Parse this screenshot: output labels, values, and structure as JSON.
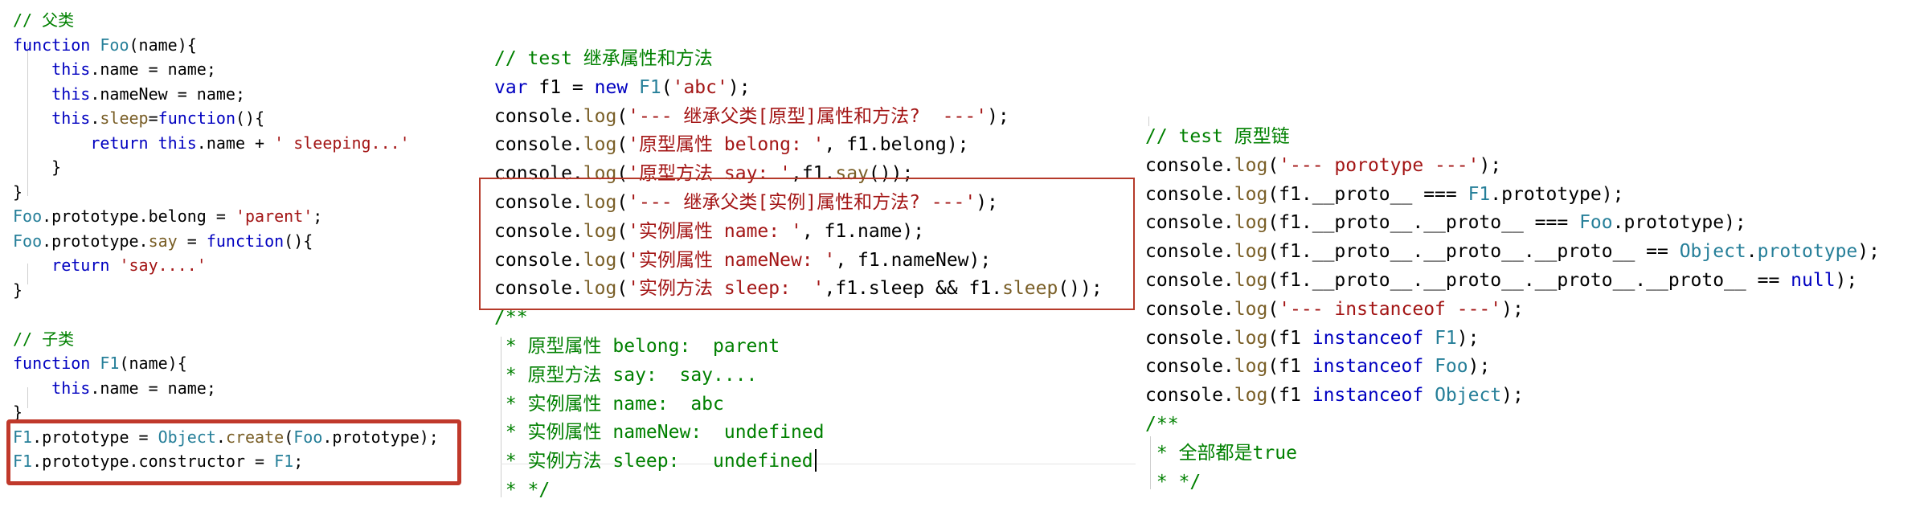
{
  "colors": {
    "keyword": "#0000c0",
    "class": "#267f99",
    "string": "#a31515",
    "comment": "#008000",
    "method": "#795e26",
    "text": "#000000",
    "highlight_box": "#c0392b"
  },
  "left_panel": {
    "lines": [
      [
        {
          "t": "// 父类",
          "c": "comment"
        }
      ],
      [
        {
          "t": "function",
          "c": "keyword"
        },
        {
          "t": " "
        },
        {
          "t": "Foo",
          "c": "class"
        },
        {
          "t": "(name){"
        }
      ],
      [
        {
          "t": "    "
        },
        {
          "t": "this",
          "c": "keyword"
        },
        {
          "t": ".name = name;"
        }
      ],
      [
        {
          "t": "    "
        },
        {
          "t": "this",
          "c": "keyword"
        },
        {
          "t": ".nameNew = name;"
        }
      ],
      [
        {
          "t": "    "
        },
        {
          "t": "this",
          "c": "keyword"
        },
        {
          "t": "."
        },
        {
          "t": "sleep",
          "c": "method"
        },
        {
          "t": "="
        },
        {
          "t": "function",
          "c": "keyword"
        },
        {
          "t": "(){"
        }
      ],
      [
        {
          "t": "        "
        },
        {
          "t": "return",
          "c": "keyword"
        },
        {
          "t": " "
        },
        {
          "t": "this",
          "c": "keyword"
        },
        {
          "t": ".name + "
        },
        {
          "t": "' sleeping...'",
          "c": "string"
        }
      ],
      [
        {
          "t": "    }"
        }
      ],
      [
        {
          "t": "}"
        }
      ],
      [
        {
          "t": "Foo",
          "c": "class"
        },
        {
          "t": ".prototype.belong = "
        },
        {
          "t": "'parent'",
          "c": "string"
        },
        {
          "t": ";"
        }
      ],
      [
        {
          "t": "Foo",
          "c": "class"
        },
        {
          "t": ".prototype."
        },
        {
          "t": "say",
          "c": "method"
        },
        {
          "t": " = "
        },
        {
          "t": "function",
          "c": "keyword"
        },
        {
          "t": "(){"
        }
      ],
      [
        {
          "t": "    "
        },
        {
          "t": "return",
          "c": "keyword"
        },
        {
          "t": " "
        },
        {
          "t": "'say....'",
          "c": "string"
        }
      ],
      [
        {
          "t": "}"
        }
      ],
      [
        {
          "t": ""
        }
      ],
      [
        {
          "t": "// 子类",
          "c": "comment"
        }
      ],
      [
        {
          "t": "function",
          "c": "keyword"
        },
        {
          "t": " "
        },
        {
          "t": "F1",
          "c": "class"
        },
        {
          "t": "(name){"
        }
      ],
      [
        {
          "t": "    "
        },
        {
          "t": "this",
          "c": "keyword"
        },
        {
          "t": ".name = name;"
        }
      ],
      [
        {
          "t": "}"
        }
      ],
      [
        {
          "t": "F1",
          "c": "class"
        },
        {
          "t": ".prototype = "
        },
        {
          "t": "Object",
          "c": "class"
        },
        {
          "t": "."
        },
        {
          "t": "create",
          "c": "method"
        },
        {
          "t": "("
        },
        {
          "t": "Foo",
          "c": "class"
        },
        {
          "t": ".prototype);"
        }
      ],
      [
        {
          "t": "F1",
          "c": "class"
        },
        {
          "t": ".prototype.constructor = "
        },
        {
          "t": "F1",
          "c": "class"
        },
        {
          "t": ";"
        }
      ]
    ]
  },
  "middle_panel": {
    "lines": [
      [
        {
          "t": "// test 继承属性和方法",
          "c": "comment"
        }
      ],
      [
        {
          "t": "var",
          "c": "keyword"
        },
        {
          "t": " f1 = "
        },
        {
          "t": "new",
          "c": "keyword"
        },
        {
          "t": " "
        },
        {
          "t": "F1",
          "c": "class"
        },
        {
          "t": "("
        },
        {
          "t": "'abc'",
          "c": "string"
        },
        {
          "t": ");"
        }
      ],
      [
        {
          "t": "console."
        },
        {
          "t": "log",
          "c": "method"
        },
        {
          "t": "("
        },
        {
          "t": "'--- 继承父类[原型]属性和方法?  ---'",
          "c": "string"
        },
        {
          "t": ");"
        }
      ],
      [
        {
          "t": "console."
        },
        {
          "t": "log",
          "c": "method"
        },
        {
          "t": "("
        },
        {
          "t": "'原型属性 belong: '",
          "c": "string"
        },
        {
          "t": ", f1.belong);"
        }
      ],
      [
        {
          "t": "console."
        },
        {
          "t": "log",
          "c": "method"
        },
        {
          "t": "("
        },
        {
          "t": "'原型方法 say: '",
          "c": "string"
        },
        {
          "t": ",f1."
        },
        {
          "t": "say",
          "c": "method"
        },
        {
          "t": "());"
        }
      ],
      [
        {
          "t": "console."
        },
        {
          "t": "log",
          "c": "method"
        },
        {
          "t": "("
        },
        {
          "t": "'--- 继承父类[实例]属性和方法? ---'",
          "c": "string"
        },
        {
          "t": ");"
        }
      ],
      [
        {
          "t": "console."
        },
        {
          "t": "log",
          "c": "method"
        },
        {
          "t": "("
        },
        {
          "t": "'实例属性 name: '",
          "c": "string"
        },
        {
          "t": ", f1.name);"
        }
      ],
      [
        {
          "t": "console."
        },
        {
          "t": "log",
          "c": "method"
        },
        {
          "t": "("
        },
        {
          "t": "'实例属性 nameNew: '",
          "c": "string"
        },
        {
          "t": ", f1.nameNew);"
        }
      ],
      [
        {
          "t": "console."
        },
        {
          "t": "log",
          "c": "method"
        },
        {
          "t": "("
        },
        {
          "t": "'实例方法 sleep:  '",
          "c": "string"
        },
        {
          "t": ",f1.sleep && f1."
        },
        {
          "t": "sleep",
          "c": "method"
        },
        {
          "t": "());"
        }
      ],
      [
        {
          "t": "/**",
          "c": "comment"
        }
      ],
      [
        {
          "t": " * 原型属性 belong:  parent",
          "c": "comment"
        }
      ],
      [
        {
          "t": " * 原型方法 say:  say....",
          "c": "comment"
        }
      ],
      [
        {
          "t": " * 实例属性 name:  abc",
          "c": "comment"
        }
      ],
      [
        {
          "t": " * 实例属性 nameNew:  undefined",
          "c": "comment"
        }
      ],
      [
        {
          "t": " * 实例方法 sleep:   undefined",
          "c": "comment"
        }
      ],
      [
        {
          "t": " * */",
          "c": "comment"
        }
      ]
    ]
  },
  "right_panel": {
    "lines": [
      [
        {
          "t": "// test 原型链",
          "c": "comment"
        }
      ],
      [
        {
          "t": "console."
        },
        {
          "t": "log",
          "c": "method"
        },
        {
          "t": "("
        },
        {
          "t": "'--- porotype ---'",
          "c": "string"
        },
        {
          "t": ");"
        }
      ],
      [
        {
          "t": "console."
        },
        {
          "t": "log",
          "c": "method"
        },
        {
          "t": "(f1.__proto__ === "
        },
        {
          "t": "F1",
          "c": "class"
        },
        {
          "t": ".prototype);"
        }
      ],
      [
        {
          "t": "console."
        },
        {
          "t": "log",
          "c": "method"
        },
        {
          "t": "(f1.__proto__.__proto__ === "
        },
        {
          "t": "Foo",
          "c": "class"
        },
        {
          "t": ".prototype);"
        }
      ],
      [
        {
          "t": "console."
        },
        {
          "t": "log",
          "c": "method"
        },
        {
          "t": "(f1.__proto__.__proto__.__proto__ == "
        },
        {
          "t": "Object",
          "c": "class"
        },
        {
          "t": "."
        },
        {
          "t": "prototype",
          "c": "class"
        },
        {
          "t": ");"
        }
      ],
      [
        {
          "t": "console."
        },
        {
          "t": "log",
          "c": "method"
        },
        {
          "t": "(f1.__proto__.__proto__.__proto__.__proto__ == "
        },
        {
          "t": "null",
          "c": "keyword"
        },
        {
          "t": ");"
        }
      ],
      [
        {
          "t": "console."
        },
        {
          "t": "log",
          "c": "method"
        },
        {
          "t": "("
        },
        {
          "t": "'--- instanceof ---'",
          "c": "string"
        },
        {
          "t": ");"
        }
      ],
      [
        {
          "t": "console."
        },
        {
          "t": "log",
          "c": "method"
        },
        {
          "t": "(f1 "
        },
        {
          "t": "instanceof",
          "c": "keyword"
        },
        {
          "t": " "
        },
        {
          "t": "F1",
          "c": "class"
        },
        {
          "t": ");"
        }
      ],
      [
        {
          "t": "console."
        },
        {
          "t": "log",
          "c": "method"
        },
        {
          "t": "(f1 "
        },
        {
          "t": "instanceof",
          "c": "keyword"
        },
        {
          "t": " "
        },
        {
          "t": "Foo",
          "c": "class"
        },
        {
          "t": ");"
        }
      ],
      [
        {
          "t": "console."
        },
        {
          "t": "log",
          "c": "method"
        },
        {
          "t": "(f1 "
        },
        {
          "t": "instanceof",
          "c": "keyword"
        },
        {
          "t": " "
        },
        {
          "t": "Object",
          "c": "class"
        },
        {
          "t": ");"
        }
      ],
      [
        {
          "t": "/**",
          "c": "comment"
        }
      ],
      [
        {
          "t": " * 全部都是true",
          "c": "comment"
        }
      ],
      [
        {
          "t": " * */",
          "c": "comment"
        }
      ]
    ]
  }
}
